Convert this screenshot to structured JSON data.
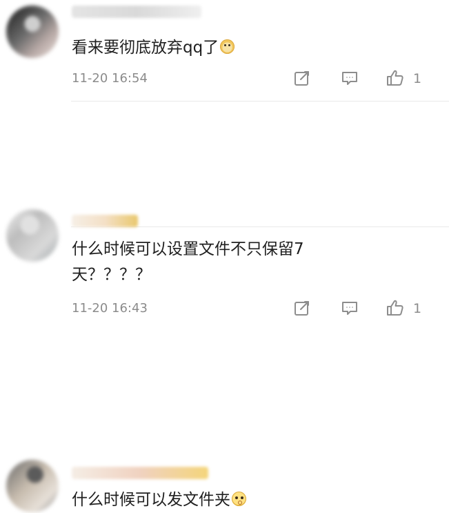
{
  "comments": [
    {
      "text": "看来要彻底放弃qq了",
      "time": "11-20 16:54",
      "likes": "1"
    },
    {
      "text_line1": "什么时候可以设置文件不只保留7",
      "text_line2": "天？？？？",
      "time": "11-20 16:43",
      "likes": "1"
    },
    {
      "text": "什么时候可以发文件夹"
    }
  ],
  "icons": {
    "edit": "edit-icon",
    "reply": "reply-icon",
    "like": "thumbs-up-icon",
    "dog_emoji": "dog-emoji",
    "thinking_emoji": "thinking-emoji"
  },
  "colors": {
    "text": "#1f1f1f",
    "meta": "#8b8b8b",
    "icon": "#8d8d8d",
    "divider": "#e9e9e9"
  }
}
